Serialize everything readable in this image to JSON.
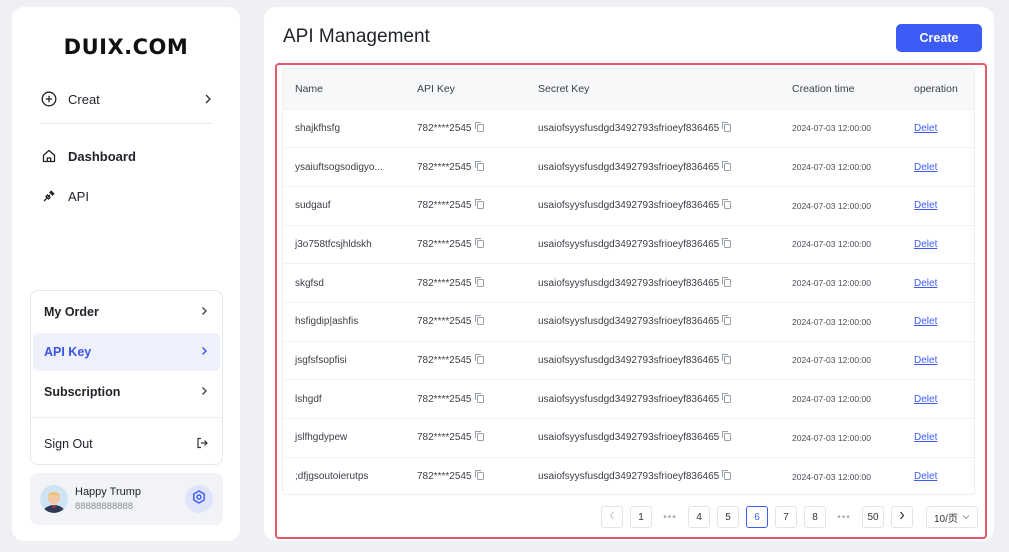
{
  "sidebar": {
    "logo": "DUIX.COM",
    "creat_label": "Creat",
    "nav": [
      {
        "label": "Dashboard",
        "icon": "home-icon"
      },
      {
        "label": "API",
        "icon": "plug-icon"
      }
    ],
    "menu": [
      {
        "label": "My Order",
        "active": false
      },
      {
        "label": "API Key",
        "active": true
      },
      {
        "label": "Subscription",
        "active": false
      }
    ],
    "signout_label": "Sign Out",
    "user": {
      "name": "Happy Trump",
      "phone": "88888888888"
    }
  },
  "main": {
    "title": "API Management",
    "create_label": "Create",
    "columns": [
      "Name",
      "API Key",
      "Secret Key",
      "Creation time",
      "operation"
    ],
    "rows": [
      {
        "name": "shajkfhsfg",
        "api_key": "782****2545",
        "secret": "usaiofsyysfusdgd3492793sfrioeyf836465",
        "time": "2024-07-03 12:00:00",
        "op": "Delet"
      },
      {
        "name": "ysaiuftsogsodigyo...",
        "api_key": "782****2545",
        "secret": "usaiofsyysfusdgd3492793sfrioeyf836465",
        "time": "2024-07-03 12:00:00",
        "op": "Delet"
      },
      {
        "name": "sudgauf",
        "api_key": "782****2545",
        "secret": "usaiofsyysfusdgd3492793sfrioeyf836465",
        "time": "2024-07-03 12:00:00",
        "op": "Delet"
      },
      {
        "name": "j3o758tfcsjhldskh",
        "api_key": "782****2545",
        "secret": "usaiofsyysfusdgd3492793sfrioeyf836465",
        "time": "2024-07-03 12:00:00",
        "op": "Delet"
      },
      {
        "name": "skgfsd",
        "api_key": "782****2545",
        "secret": "usaiofsyysfusdgd3492793sfrioeyf836465",
        "time": "2024-07-03 12:00:00",
        "op": "Delet"
      },
      {
        "name": "hsfigdip|ashfis",
        "api_key": "782****2545",
        "secret": "usaiofsyysfusdgd3492793sfrioeyf836465",
        "time": "2024-07-03 12:00:00",
        "op": "Delet"
      },
      {
        "name": "jsgfsfsopfisi",
        "api_key": "782****2545",
        "secret": "usaiofsyysfusdgd3492793sfrioeyf836465",
        "time": "2024-07-03 12:00:00",
        "op": "Delet"
      },
      {
        "name": "lshgdf",
        "api_key": "782****2545",
        "secret": "usaiofsyysfusdgd3492793sfrioeyf836465",
        "time": "2024-07-03 12:00:00",
        "op": "Delet"
      },
      {
        "name": "jslfhgdypew",
        "api_key": "782****2545",
        "secret": "usaiofsyysfusdgd3492793sfrioeyf836465",
        "time": "2024-07-03 12:00:00",
        "op": "Delet"
      },
      {
        "name": ";dfjgsoutoierutps",
        "api_key": "782****2545",
        "secret": "usaiofsyysfusdgd3492793sfrioeyf836465",
        "time": "2024-07-03 12:00:00",
        "op": "Delet"
      }
    ],
    "pagination": {
      "pages": [
        "1",
        "4",
        "5",
        "6",
        "7",
        "8",
        "50"
      ],
      "current": "6",
      "ellipsis": "•••",
      "page_size": "10/页"
    }
  },
  "colors": {
    "accent": "#3d5cf5",
    "highlight": "#e4566a",
    "active_bg": "#eef0fb"
  }
}
